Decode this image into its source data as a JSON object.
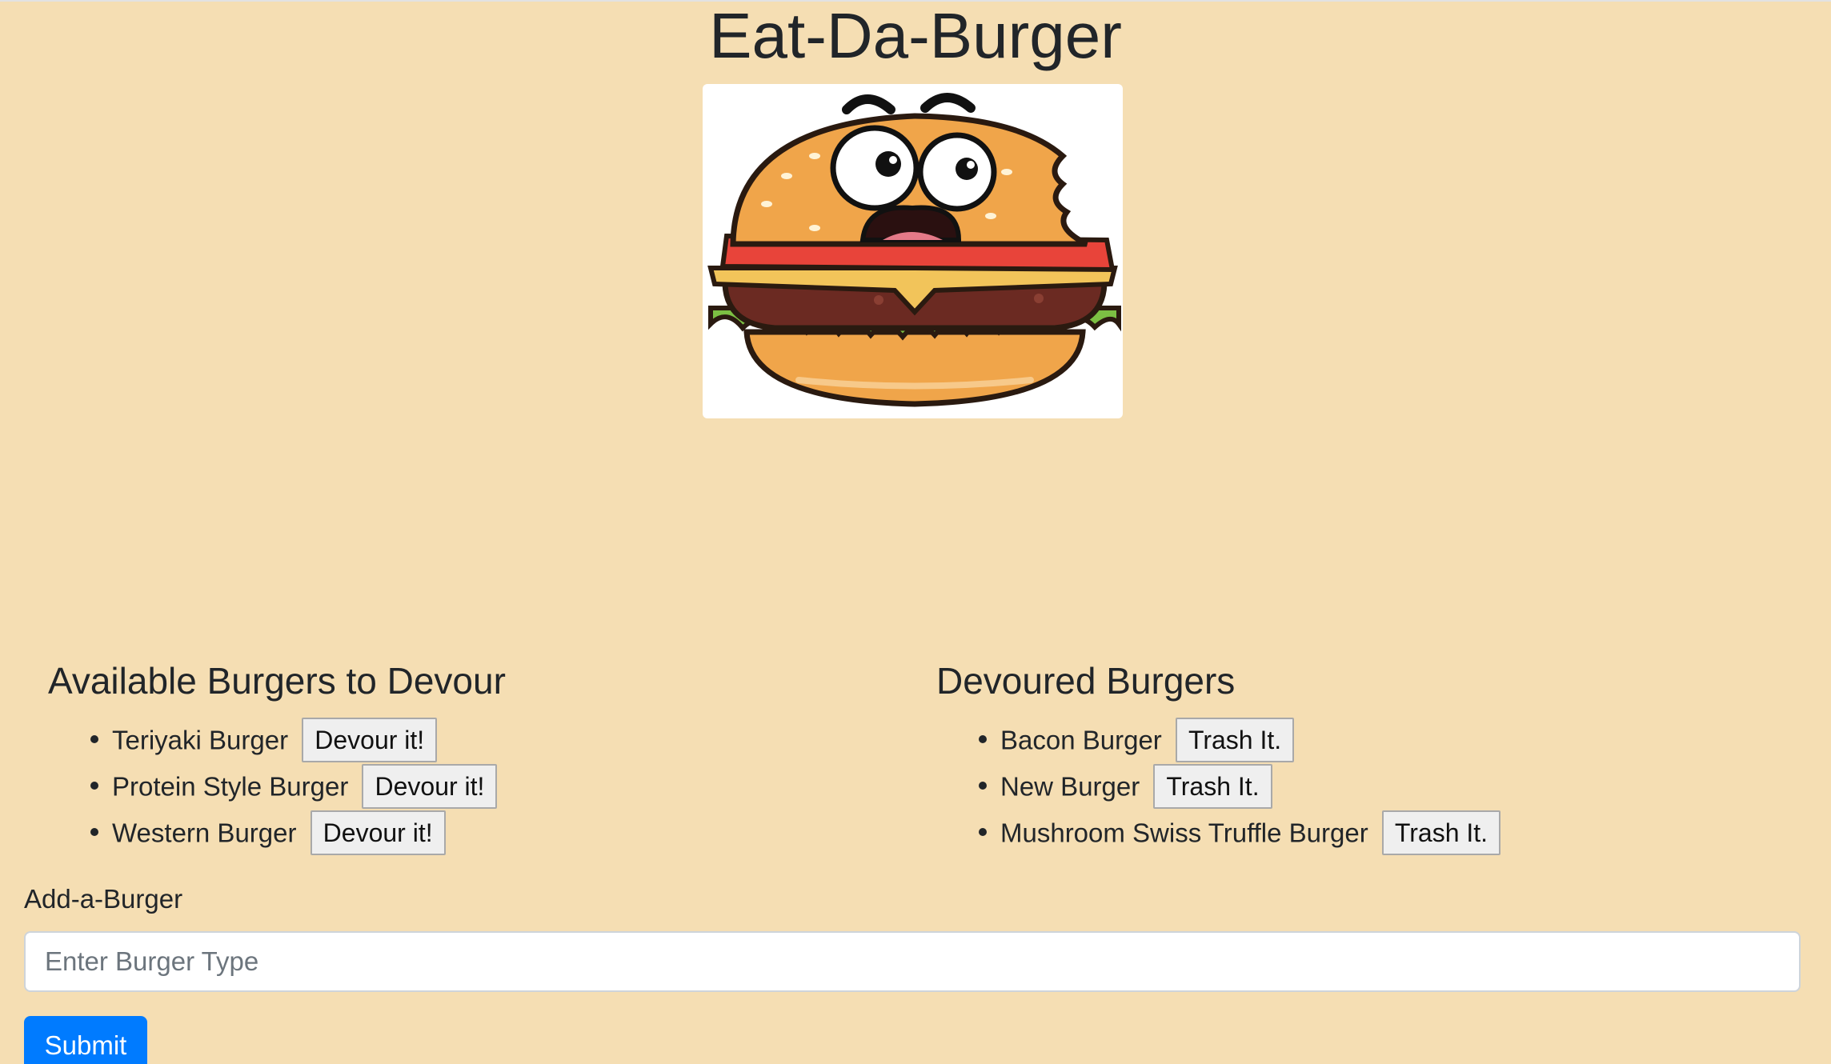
{
  "header": {
    "title": "Eat-Da-Burger"
  },
  "hero_image": {
    "icon": "cartoon-burger-mascot",
    "colors": {
      "bun": "#f0a54a",
      "patty": "#6b2a22",
      "lettuce": "#7cc043",
      "tomato": "#e8443a",
      "cheese": "#f2c45a"
    }
  },
  "available": {
    "heading": "Available Burgers to Devour",
    "items": [
      {
        "name": "Teriyaki Burger",
        "action": "Devour it!"
      },
      {
        "name": "Protein Style Burger",
        "action": "Devour it!"
      },
      {
        "name": "Western Burger",
        "action": "Devour it!"
      }
    ]
  },
  "devoured": {
    "heading": "Devoured Burgers",
    "items": [
      {
        "name": "Bacon Burger",
        "action": "Trash It."
      },
      {
        "name": "New Burger",
        "action": "Trash It."
      },
      {
        "name": "Mushroom Swiss Truffle Burger",
        "action": "Trash It."
      }
    ]
  },
  "form": {
    "label": "Add-a-Burger",
    "placeholder": "Enter Burger Type",
    "value": "",
    "submit_label": "Submit"
  },
  "theme": {
    "background": "#f5deb3",
    "primary": "#007bff"
  }
}
